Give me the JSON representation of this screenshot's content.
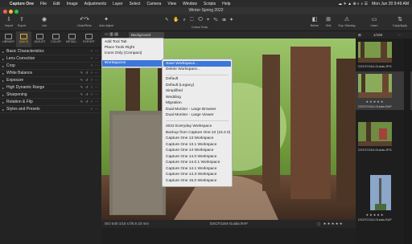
{
  "menubar": {
    "app": "Capture One",
    "items": [
      "File",
      "Edit",
      "Image",
      "Adjustments",
      "Layer",
      "Select",
      "Camera",
      "View",
      "Window",
      "Scripts",
      "Help"
    ],
    "clock": "Mon Jun 20  9:49 AM"
  },
  "window": {
    "title": "Winter-Spring 2022"
  },
  "toolbar": {
    "import": "Import",
    "export": "Export",
    "live": "Live",
    "undo_redo": "Undo/Redo",
    "auto_adjust": "Auto Adjust",
    "cursor_tools": "Cursor Tools",
    "before": "Before",
    "grid": "Grid",
    "exp_warning": "Exp. Warning",
    "learn": "Learn",
    "copy_apply": "Copy/Apply"
  },
  "tool_tabs": [
    {
      "label": "LIBRARY",
      "active": false
    },
    {
      "label": "QUICK",
      "active": true
    },
    {
      "label": "ADJUST",
      "active": false
    },
    {
      "label": "COLOR",
      "active": false
    },
    {
      "label": "METAD...",
      "active": false
    },
    {
      "label": "EXPORT",
      "active": false
    }
  ],
  "tools": [
    "Basic Characteristics",
    "Lens Correction",
    "Crop",
    "White Balance",
    "Exposure",
    "High Dynamic Range",
    "Sharpening",
    "Rotation & Flip",
    "Styles and Presets"
  ],
  "viewer": {
    "background_select": "Background",
    "footer_left": "ISO 640   1/15 s   f/5.6   23 mm",
    "footer_name": "DSCF2184-Guiala.RAF"
  },
  "context_menu": {
    "items": [
      "Add Tool Tab",
      "Place Tools Right",
      "Icons Only (Compact)"
    ],
    "workspaces": "Workspaces"
  },
  "submenu": {
    "save": "Save Workspace...",
    "delete": "Delete Workspace...",
    "group1": [
      "Default",
      "Default (Legacy)",
      "Simplified",
      "Wedding",
      "Migration",
      "Dual Monitor - Large Browser",
      "Dual Monitor - Large Viewer"
    ],
    "group2": [
      "2022 Everyday Workspace",
      "Backup from Capture One 22 (15.2.0)",
      "Capture One 13 Workspace",
      "Capture One 13.1 Workspace",
      "Capture One 14 Workspace",
      "Capture One 14.0 Workspace",
      "Capture One 14.0.1 Workspace",
      "Capture One 14.1 Workspace",
      "Capture One 14.3 Workspace",
      "Capture One 15.0 Workspace"
    ]
  },
  "browser": {
    "count": "1/160",
    "thumbs": [
      {
        "name": "DSCF2164-Guiala.JPG"
      },
      {
        "name": "DSCF2164-Guiala.RAF",
        "selected": true
      },
      {
        "name": "DSCF2163-Guiala.JPG"
      },
      {
        "name": "DSCF2163-Guiala.RAF"
      }
    ]
  }
}
